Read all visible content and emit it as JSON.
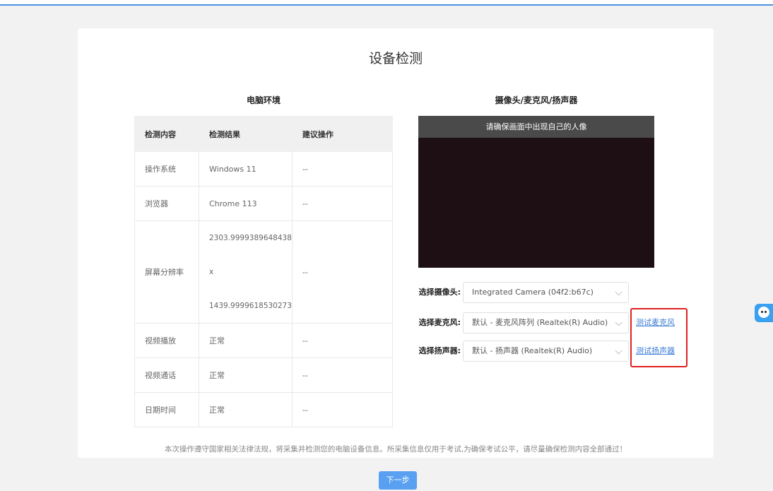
{
  "page": {
    "title": "设备检测",
    "notice": "本次操作遵守国家相关法律法规，将采集并检测您的电脑设备信息。所采集信息仅用于考试,为确保考试公平，请尽量确保检测内容全部通过！",
    "next_button": "下一步"
  },
  "environment": {
    "title": "电脑环境",
    "headers": [
      "检测内容",
      "检测结果",
      "建议操作"
    ],
    "rows": [
      {
        "item": "操作系统",
        "result": "Windows 11",
        "action": "--"
      },
      {
        "item": "浏览器",
        "result": "Chrome 113",
        "action": "--"
      },
      {
        "item": "屏幕分辨率",
        "result_lines": [
          "2303.9999389648438",
          "x",
          "1439.9999618530273"
        ],
        "action": "--"
      },
      {
        "item": "视频播放",
        "result": "正常",
        "action": "--"
      },
      {
        "item": "视频通话",
        "result": "正常",
        "action": "--"
      },
      {
        "item": "日期时间",
        "result": "正常",
        "action": "--"
      }
    ]
  },
  "devices": {
    "title": "摄像头/麦克风/扬声器",
    "video_banner": "请确保画面中出现自己的人像",
    "camera": {
      "label": "选择摄像头:",
      "value": "Integrated Camera (04f2:b67c)"
    },
    "microphone": {
      "label": "选择麦克风:",
      "value": "默认 - 麦克风阵列 (Realtek(R) Audio)",
      "test_link": "测试麦克风"
    },
    "speaker": {
      "label": "选择扬声器:",
      "value": "默认 - 扬声器 (Realtek(R) Audio)",
      "test_link": "测试扬声器"
    }
  },
  "colors": {
    "accent": "#4a90e2",
    "highlight": "#e02020",
    "link": "#3a7bd5"
  }
}
